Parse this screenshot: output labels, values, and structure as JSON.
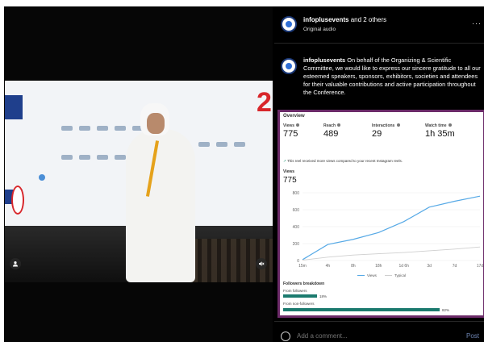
{
  "header": {
    "account": "infoplusevents",
    "others": "and 2 others",
    "audio": "Original audio",
    "more_icon": "more-horizontal-icon"
  },
  "caption": {
    "account": "infoplusevents",
    "text": "On behalf of the Organizing & Scientific Committee, we would like to express our sincere gratitude to all our esteemed speakers, sponsors, exhibitors, societies and attendees for their valuable contributions and active participation throughout the Conference."
  },
  "insights": {
    "title": "Overview",
    "metrics": [
      {
        "label": "Views",
        "value": "775"
      },
      {
        "label": "Reach",
        "value": "489"
      },
      {
        "label": "Interactions",
        "value": "29"
      },
      {
        "label": "Watch time",
        "value": "1h 35m"
      }
    ],
    "note": "This reel received more views compared to your recent Instagram reels.",
    "views_label": "Views",
    "views_value": "775",
    "legend": {
      "views": "Views",
      "typical": "Typical"
    },
    "followers_breakdown": {
      "title": "Followers breakdown",
      "from_followers": {
        "label": "From followers",
        "pct_text": "18%",
        "fraction": 0.18
      },
      "from_non_followers": {
        "label": "From non-followers",
        "pct_text": "82%",
        "fraction": 0.82
      }
    }
  },
  "chart_data": {
    "type": "line",
    "x": [
      "15m",
      "4h",
      "8h",
      "18h",
      "1d 6h",
      "3d",
      "7d",
      "17d"
    ],
    "ylim": [
      0,
      800
    ],
    "yticks": [
      0,
      200,
      400,
      600,
      800
    ],
    "series": [
      {
        "name": "Views",
        "color": "#56a9e6",
        "values": [
          10,
          190,
          250,
          330,
          460,
          630,
          700,
          760
        ]
      },
      {
        "name": "Typical",
        "color": "#cfcfcf",
        "values": [
          5,
          40,
          65,
          80,
          95,
          115,
          135,
          160
        ]
      }
    ]
  },
  "comment": {
    "placeholder": "Add a comment...",
    "post_label": "Post"
  },
  "colors": {
    "card_border": "#6b2a68",
    "bar_fill": "#1b7a6e",
    "views_line": "#56a9e6"
  }
}
